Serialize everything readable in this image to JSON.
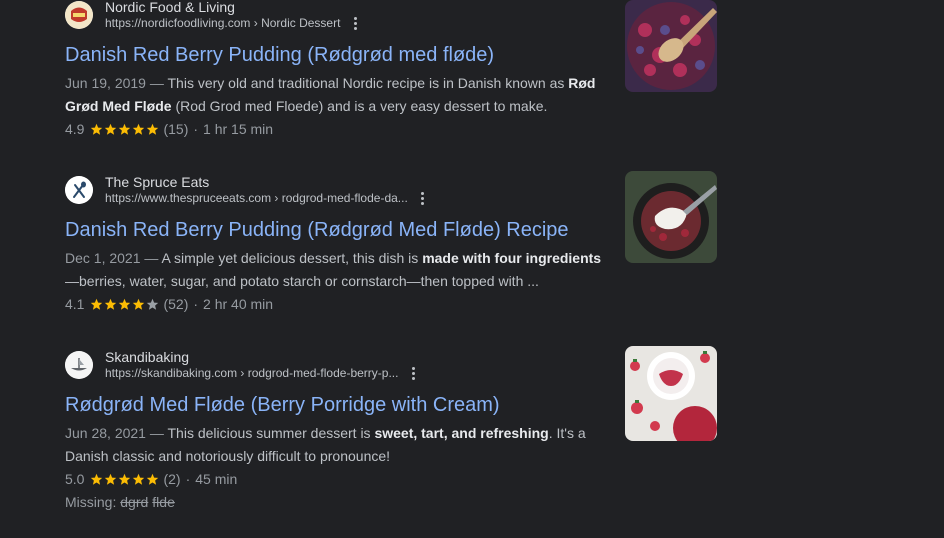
{
  "results": [
    {
      "site_name": "Nordic Food & Living",
      "url": "https://nordicfoodliving.com › Nordic Dessert",
      "title": "Danish Red Berry Pudding (Rødgrød med fløde)",
      "date": "Jun 19, 2019",
      "snippet_a": "This very old and traditional Nordic recipe is in Danish known as ",
      "snippet_b": "Rød Grød Med Fløde",
      "snippet_c": " (Rod Grod med Floede) and is a very easy dessert to make.",
      "rating": "4.9",
      "reviews": "(15)",
      "time": "1 hr 15 min",
      "stars_value": 5,
      "favicon_icon": "nordic-food-logo-icon",
      "thumb_icon": "berry-bowl-spoon-image"
    },
    {
      "site_name": "The Spruce Eats",
      "url": "https://www.thespruceeats.com › rodgrod-med-flode-da...",
      "title": "Danish Red Berry Pudding (Rødgrød Med Fløde) Recipe",
      "date": "Dec 1, 2021",
      "snippet_a": "A simple yet delicious dessert, this dish is ",
      "snippet_b": "made with four ingredients",
      "snippet_c": " —berries, water, sugar, and potato starch or cornstarch—then topped with ...",
      "rating": "4.1",
      "reviews": "(52)",
      "time": "2 hr 40 min",
      "stars_value": 4,
      "favicon_icon": "spoon-fork-icon",
      "thumb_icon": "bowl-cream-berries-image"
    },
    {
      "site_name": "Skandibaking",
      "url": "https://skandibaking.com › rodgrod-med-flode-berry-p...",
      "title": "Rødgrød Med Fløde (Berry Porridge with Cream)",
      "date": "Jun 28, 2021",
      "snippet_a": "This delicious summer dessert is ",
      "snippet_b": "sweet, tart, and refreshing",
      "snippet_c": ". It's a Danish classic and notoriously difficult to pronounce!",
      "rating": "5.0",
      "reviews": "(2)",
      "time": "45 min",
      "stars_value": 5,
      "favicon_icon": "viking-ship-icon",
      "thumb_icon": "strawberry-cream-bowl-image",
      "missing_label": "Missing:",
      "missing_terms": [
        "dgrd",
        "flde"
      ]
    }
  ],
  "separator": "·",
  "dash": "—",
  "colors": {
    "background": "#202124",
    "link": "#8ab4f8",
    "star": "#fbbc04"
  }
}
